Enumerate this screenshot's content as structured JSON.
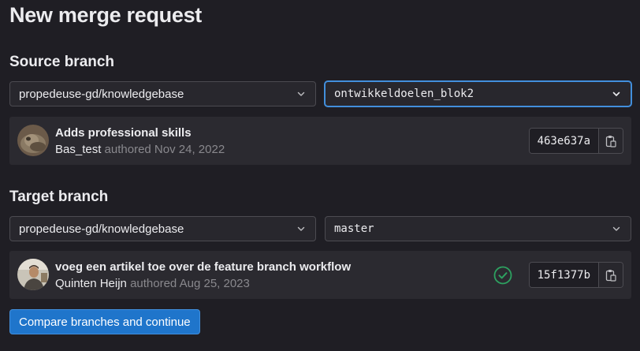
{
  "page": {
    "title": "New merge request"
  },
  "source": {
    "heading": "Source branch",
    "project": "propedeuse-gd/knowledgebase",
    "branch": "ontwikkeldoelen_blok2",
    "commit": {
      "title": "Adds professional skills",
      "author": "Bas_test",
      "authored_text": "authored Nov 24, 2022",
      "sha": "463e637a"
    }
  },
  "target": {
    "heading": "Target branch",
    "project": "propedeuse-gd/knowledgebase",
    "branch": "master",
    "commit": {
      "title": "voeg een artikel toe over de feature branch workflow",
      "author": "Quinten Heijn",
      "authored_text": "authored Aug 25, 2023",
      "sha": "15f1377b",
      "pipeline_status": "success"
    }
  },
  "actions": {
    "compare_label": "Compare branches and continue"
  },
  "colors": {
    "background": "#1f1e24",
    "panel": "#2b2a30",
    "focus": "#428fdc",
    "primary": "#1f75cb",
    "success": "#2da160"
  },
  "icons": {
    "dropdown": "chevron-down-icon",
    "copy": "clipboard-icon",
    "status": "check-circle-icon"
  }
}
